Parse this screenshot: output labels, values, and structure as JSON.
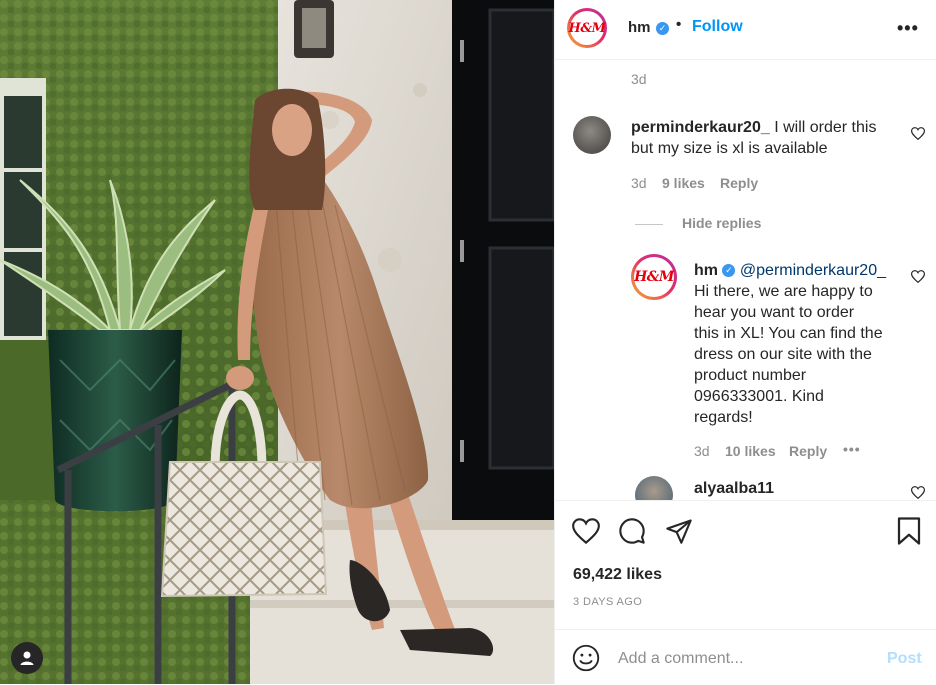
{
  "post": {
    "account": {
      "username": "hm",
      "logo_text": "H&M",
      "follow_label": "Follow",
      "separator": "•",
      "more_label": "•••"
    },
    "caption_age": "3d",
    "comments": [
      {
        "username": "perminderkaur20_",
        "text": "I will order this but my size is xl is available",
        "line1": "I will order this",
        "line2": "but my size is xl is available",
        "age": "3d",
        "likes": "9 likes",
        "reply_label": "Reply",
        "hide_replies_label": "Hide replies",
        "replies": [
          {
            "username": "hm",
            "mention": "@perminderkaur20_",
            "text_lines": [
              "Hi there, we are happy to",
              "hear you want to order",
              "this in XL! You can find the",
              "dress on our site with the",
              "product number",
              "0966333001. Kind",
              "regards!"
            ],
            "age": "3d",
            "likes": "10 likes",
            "reply_label": "Reply",
            "more_label": "•••"
          }
        ]
      },
      {
        "username": "alyaalba11"
      }
    ],
    "likes_count": "69,422 likes",
    "date": "3 DAYS AGO",
    "comment_box": {
      "placeholder": "Add a comment...",
      "post_label": "Post"
    }
  },
  "colors": {
    "accent": "#0095f6",
    "verified": "#3897f0",
    "muted": "#8e8e8e",
    "text": "#262626",
    "brand_red": "#e50010"
  },
  "icons": [
    "heart-icon",
    "comment-icon",
    "share-icon",
    "bookmark-icon",
    "emoji-icon",
    "more-icon",
    "user-tag-icon",
    "verified-badge-icon"
  ]
}
